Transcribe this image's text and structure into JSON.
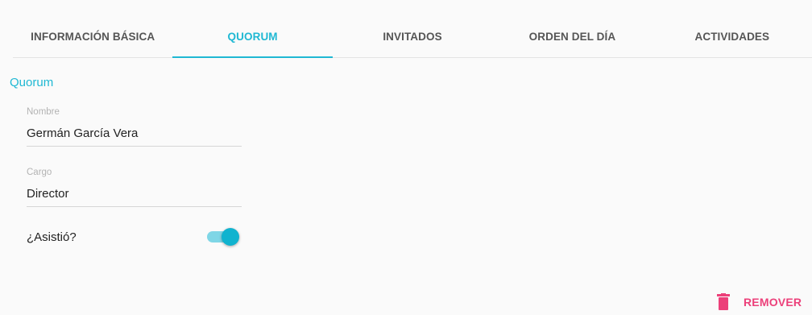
{
  "tabs": [
    {
      "label": "INFORMACIÓN BÁSICA",
      "active": false
    },
    {
      "label": "QUORUM",
      "active": true
    },
    {
      "label": "INVITADOS",
      "active": false
    },
    {
      "label": "ORDEN DEL DÍA",
      "active": false
    },
    {
      "label": "ACTIVIDADES",
      "active": false
    }
  ],
  "section": {
    "title": "Quorum"
  },
  "form": {
    "nombre": {
      "label": "Nombre",
      "value": "Germán García Vera"
    },
    "cargo": {
      "label": "Cargo",
      "value": "Director"
    },
    "asistio": {
      "label": "¿Asistió?",
      "checked": true
    }
  },
  "actions": {
    "remove_label": "REMOVER",
    "remove_icon": "trash-icon"
  },
  "colors": {
    "accent": "#1fb8d3",
    "danger": "#ec407a",
    "tab_text": "#555555"
  }
}
